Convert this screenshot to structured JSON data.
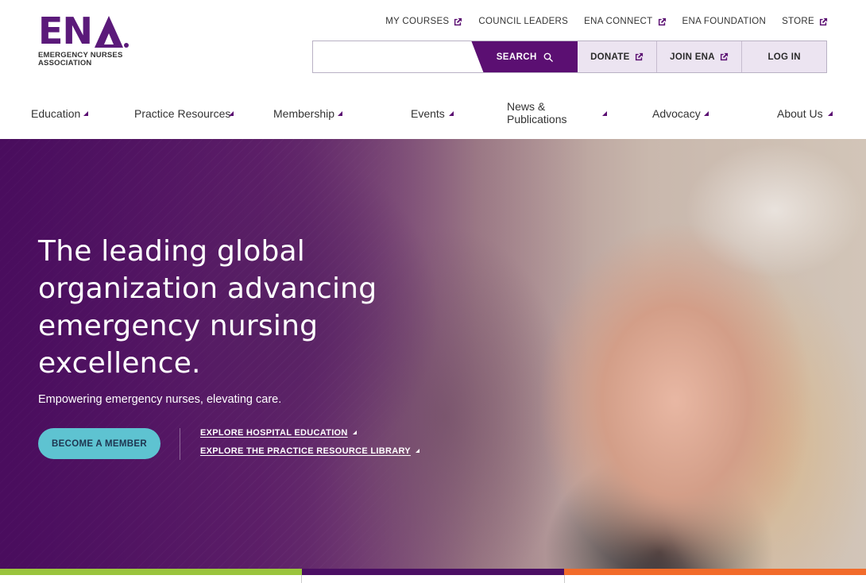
{
  "logo": {
    "mark": "ENA",
    "line1": "EMERGENCY NURSES",
    "line2": "ASSOCIATION"
  },
  "utility_nav": [
    {
      "label": "MY COURSES",
      "external": true
    },
    {
      "label": "COUNCIL LEADERS",
      "external": false
    },
    {
      "label": "ENA CONNECT",
      "external": true
    },
    {
      "label": "ENA FOUNDATION",
      "external": false
    },
    {
      "label": "STORE",
      "external": true
    }
  ],
  "search": {
    "placeholder": "",
    "value": "",
    "button_label": "SEARCH"
  },
  "ctas": {
    "donate": "DONATE",
    "join": "JOIN ENA",
    "login": "LOG IN"
  },
  "main_nav": [
    {
      "label": "Education"
    },
    {
      "label": "Practice Resources"
    },
    {
      "label": "Membership"
    },
    {
      "label": "Events"
    },
    {
      "label_line1": "News &",
      "label_line2": "Publications"
    },
    {
      "label": "Advocacy"
    },
    {
      "label": "About Us"
    }
  ],
  "hero": {
    "title_line1": "The leading global",
    "title_line2": "organization advancing",
    "title_line3": "emergency nursing",
    "title_line4": "excellence.",
    "subtitle": "Empowering emergency nurses, elevating care.",
    "primary_button": "BECOME A MEMBER",
    "link1": "EXPLORE HOSPITAL EDUCATION",
    "link2": "EXPLORE THE PRACTICE RESOURCE LIBRARY"
  },
  "colors": {
    "brand_purple": "#5b0f72",
    "cta_bg": "#ece4f1",
    "member_button": "#5ec3d1",
    "strip_green": "#9ac43c",
    "strip_purple": "#4b0e63",
    "strip_orange": "#f26b2a"
  }
}
